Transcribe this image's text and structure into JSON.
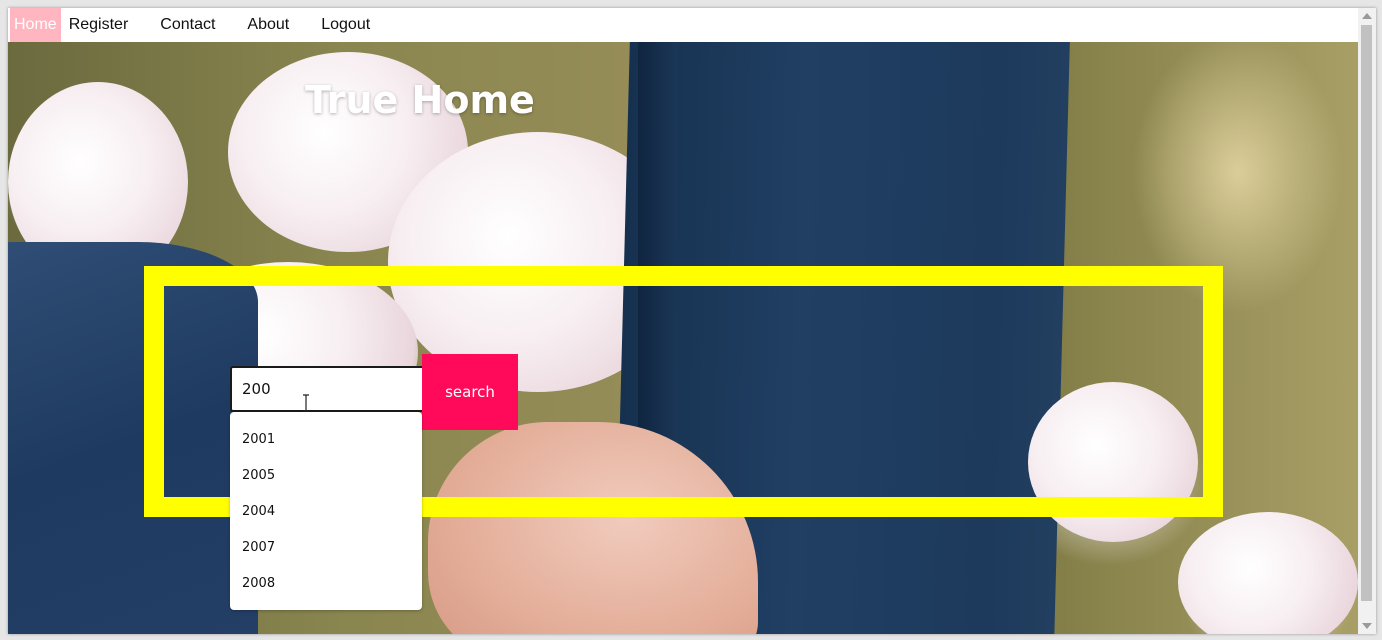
{
  "nav": {
    "items": [
      {
        "label": "Home",
        "active": true
      },
      {
        "label": "Register",
        "active": false
      },
      {
        "label": "Contact",
        "active": false
      },
      {
        "label": "About",
        "active": false
      },
      {
        "label": "Logout",
        "active": false
      }
    ]
  },
  "hero": {
    "title": "True Home"
  },
  "search": {
    "value": "200",
    "button_label": "search",
    "suggestions": [
      "2001",
      "2005",
      "2004",
      "2007",
      "2008"
    ]
  },
  "colors": {
    "active_nav_bg": "#ffb6c1",
    "frame": "#ffff00",
    "button": "#ff0a5a"
  },
  "icons": {
    "cursor": "text-cursor-icon"
  }
}
